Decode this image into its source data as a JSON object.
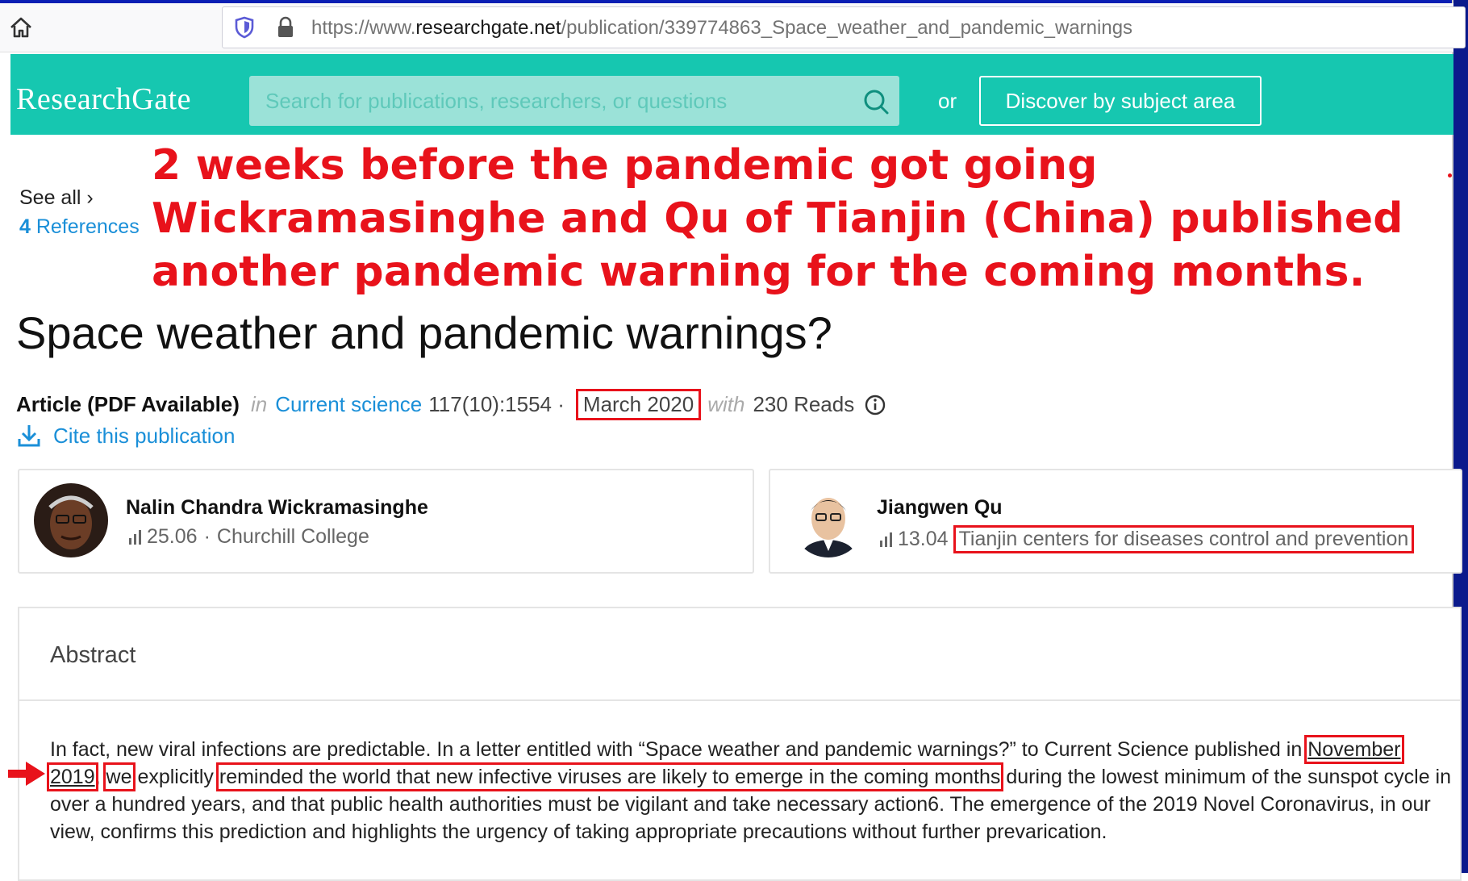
{
  "browser": {
    "url_prefix": "https://www.",
    "url_domain": "researchgate.net",
    "url_path": "/publication/339774863_Space_weather_and_pandemic_warnings"
  },
  "header": {
    "logo": "ResearchGate",
    "search_placeholder": "Search for publications, researchers, or questions",
    "or_text": "or",
    "discover_label": "Discover by subject area",
    "brand_color": "#16c7b0"
  },
  "sidebar": {
    "see_all": "See all ›",
    "ref_count": "4",
    "ref_label": " References"
  },
  "annotation": {
    "text": "2 weeks before the pandemic got going Wickramasinghe and Qu of Tianjin (China) published another pandemic warning for the coming months.",
    "color": "#e8121b"
  },
  "publication": {
    "title": "Space weather and pandemic warnings?",
    "article_type": "Article (PDF Available)",
    "in_word": "in",
    "journal": "Current science",
    "volume": "117(10):1554 ·",
    "date": "March 2020",
    "with_word": "with",
    "reads": "230 Reads",
    "cite_label": "Cite this publication"
  },
  "authors": [
    {
      "name": "Nalin Chandra Wickramasinghe",
      "score": "25.06",
      "sep": "·",
      "institution": "Churchill College"
    },
    {
      "name": "Jiangwen Qu",
      "score": "13.04",
      "sep": "·",
      "institution": "Tianjin centers for diseases control and prevention"
    }
  ],
  "abstract": {
    "heading": "Abstract",
    "p1": "In fact, new viral infections are predictable. In a letter entitled with “Space weather and pandemic warnings?” to Current Science published in ",
    "date": "November 2019",
    "p2": ", ",
    "we": "we",
    "p3": " explicitly ",
    "highlight": "reminded the world that new infective viruses are likely to emerge in the coming months",
    "p4": " during the lowest minimum of the sunspot cycle in over a hundred years, and that public health authorities must be vigilant and take necessary action6. The emergence of the 2019 Novel Coronavirus, in our view, confirms this prediction and highlights the urgency of taking appropriate precautions without further prevarication."
  }
}
